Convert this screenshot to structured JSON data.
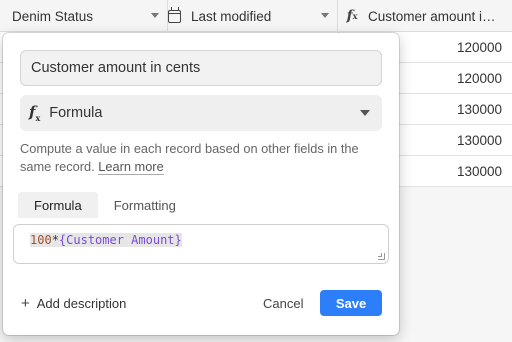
{
  "grid": {
    "columns": [
      {
        "label": "Denim Status",
        "icon": "single-line-text-icon"
      },
      {
        "label": "Last modified",
        "icon": "calendar-icon"
      },
      {
        "label": "Customer amount i…",
        "icon": "formula-icon"
      }
    ],
    "rows": [
      {
        "customer_amount_cents": "120000"
      },
      {
        "customer_amount_cents": "120000"
      },
      {
        "customer_amount_cents": "130000"
      },
      {
        "customer_amount_cents": "130000"
      },
      {
        "customer_amount_cents": "130000"
      }
    ]
  },
  "popover": {
    "field_name": "Customer amount in cents",
    "field_type": "Formula",
    "help_text": "Compute a value in each record based on other fields in the same record.",
    "learn_more": "Learn more",
    "tabs": [
      {
        "label": "Formula",
        "active": true
      },
      {
        "label": "Formatting",
        "active": false
      }
    ],
    "formula": {
      "number": "100",
      "operator": "*",
      "field_ref": "{Customer Amount}"
    },
    "add_description": "Add description",
    "cancel_label": "Cancel",
    "save_label": "Save"
  },
  "colors": {
    "accent": "#2d7ff9",
    "formula_field": "#7b4bd6",
    "formula_number": "#a0522d"
  }
}
